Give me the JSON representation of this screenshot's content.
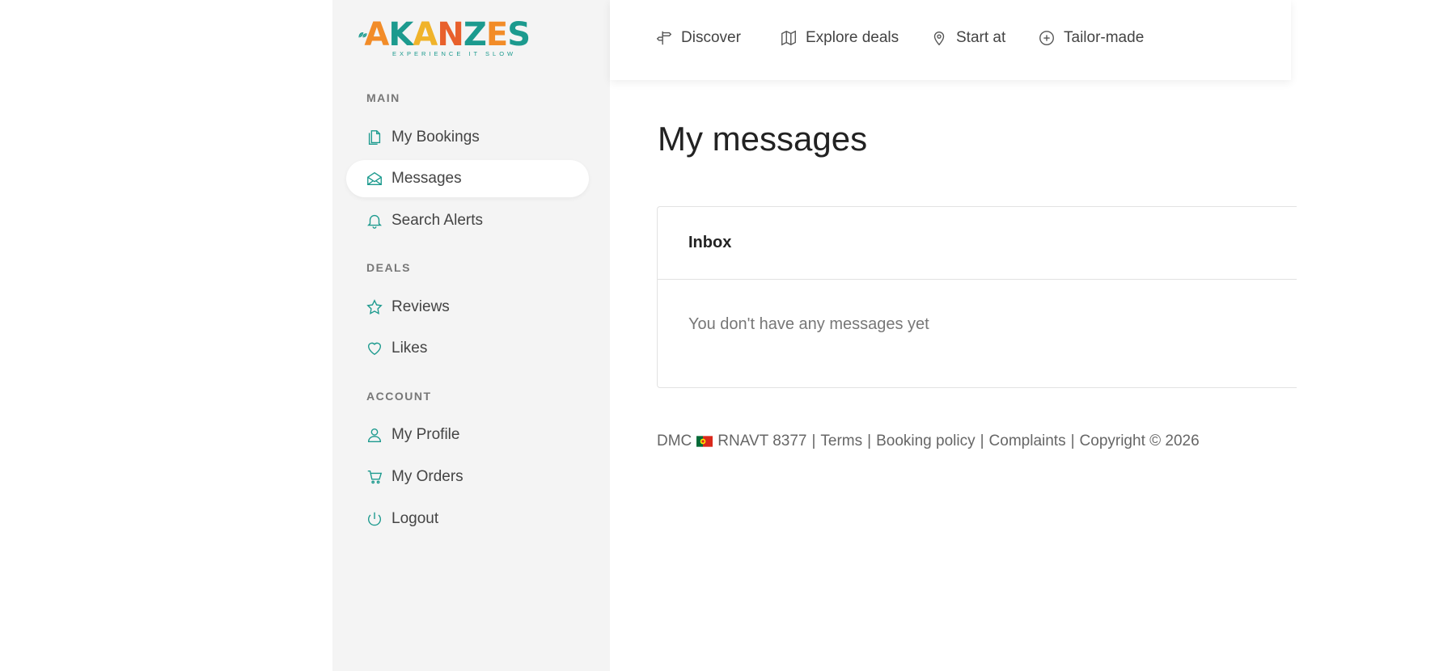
{
  "brand": {
    "name": "AKANZES",
    "tagline": "EXPERIENCE IT SLOW",
    "letter_colors": [
      "#f28c28",
      "#1c9a8e",
      "#f0b32a",
      "#e8602c",
      "#1c9a8e",
      "#f28c28",
      "#1c9a8e"
    ]
  },
  "sidebar": {
    "sections": [
      {
        "label": "MAIN"
      },
      {
        "label": "DEALS"
      },
      {
        "label": "ACCOUNT"
      }
    ],
    "items": [
      {
        "label": "My Bookings",
        "icon": "documents-icon"
      },
      {
        "label": "Messages",
        "icon": "envelope-open-icon",
        "active": true
      },
      {
        "label": "Search Alerts",
        "icon": "bell-icon"
      },
      {
        "label": "Reviews",
        "icon": "star-icon"
      },
      {
        "label": "Likes",
        "icon": "heart-icon"
      },
      {
        "label": "My Profile",
        "icon": "user-icon"
      },
      {
        "label": "My Orders",
        "icon": "cart-icon"
      },
      {
        "label": "Logout",
        "icon": "power-icon"
      }
    ]
  },
  "topnav": {
    "items": [
      {
        "label": "Discover",
        "icon": "signpost-icon"
      },
      {
        "label": "Explore deals",
        "icon": "map-icon"
      },
      {
        "label": "Start at",
        "icon": "map-pin-icon"
      },
      {
        "label": "Tailor-made",
        "icon": "plus-circle-icon"
      }
    ]
  },
  "main": {
    "title": "My messages",
    "inbox": {
      "header": "Inbox",
      "empty_text": "You don't have any messages yet"
    }
  },
  "footer": {
    "dmc": "DMC",
    "flag": "portugal-flag-icon",
    "registration": "RNAVT 8377",
    "links": [
      "Terms",
      "Booking policy",
      "Complaints"
    ],
    "copyright": "Copyright © 2026"
  },
  "colors": {
    "accent": "#1c9a8e",
    "sidebar_bg": "#f4f4f4"
  }
}
